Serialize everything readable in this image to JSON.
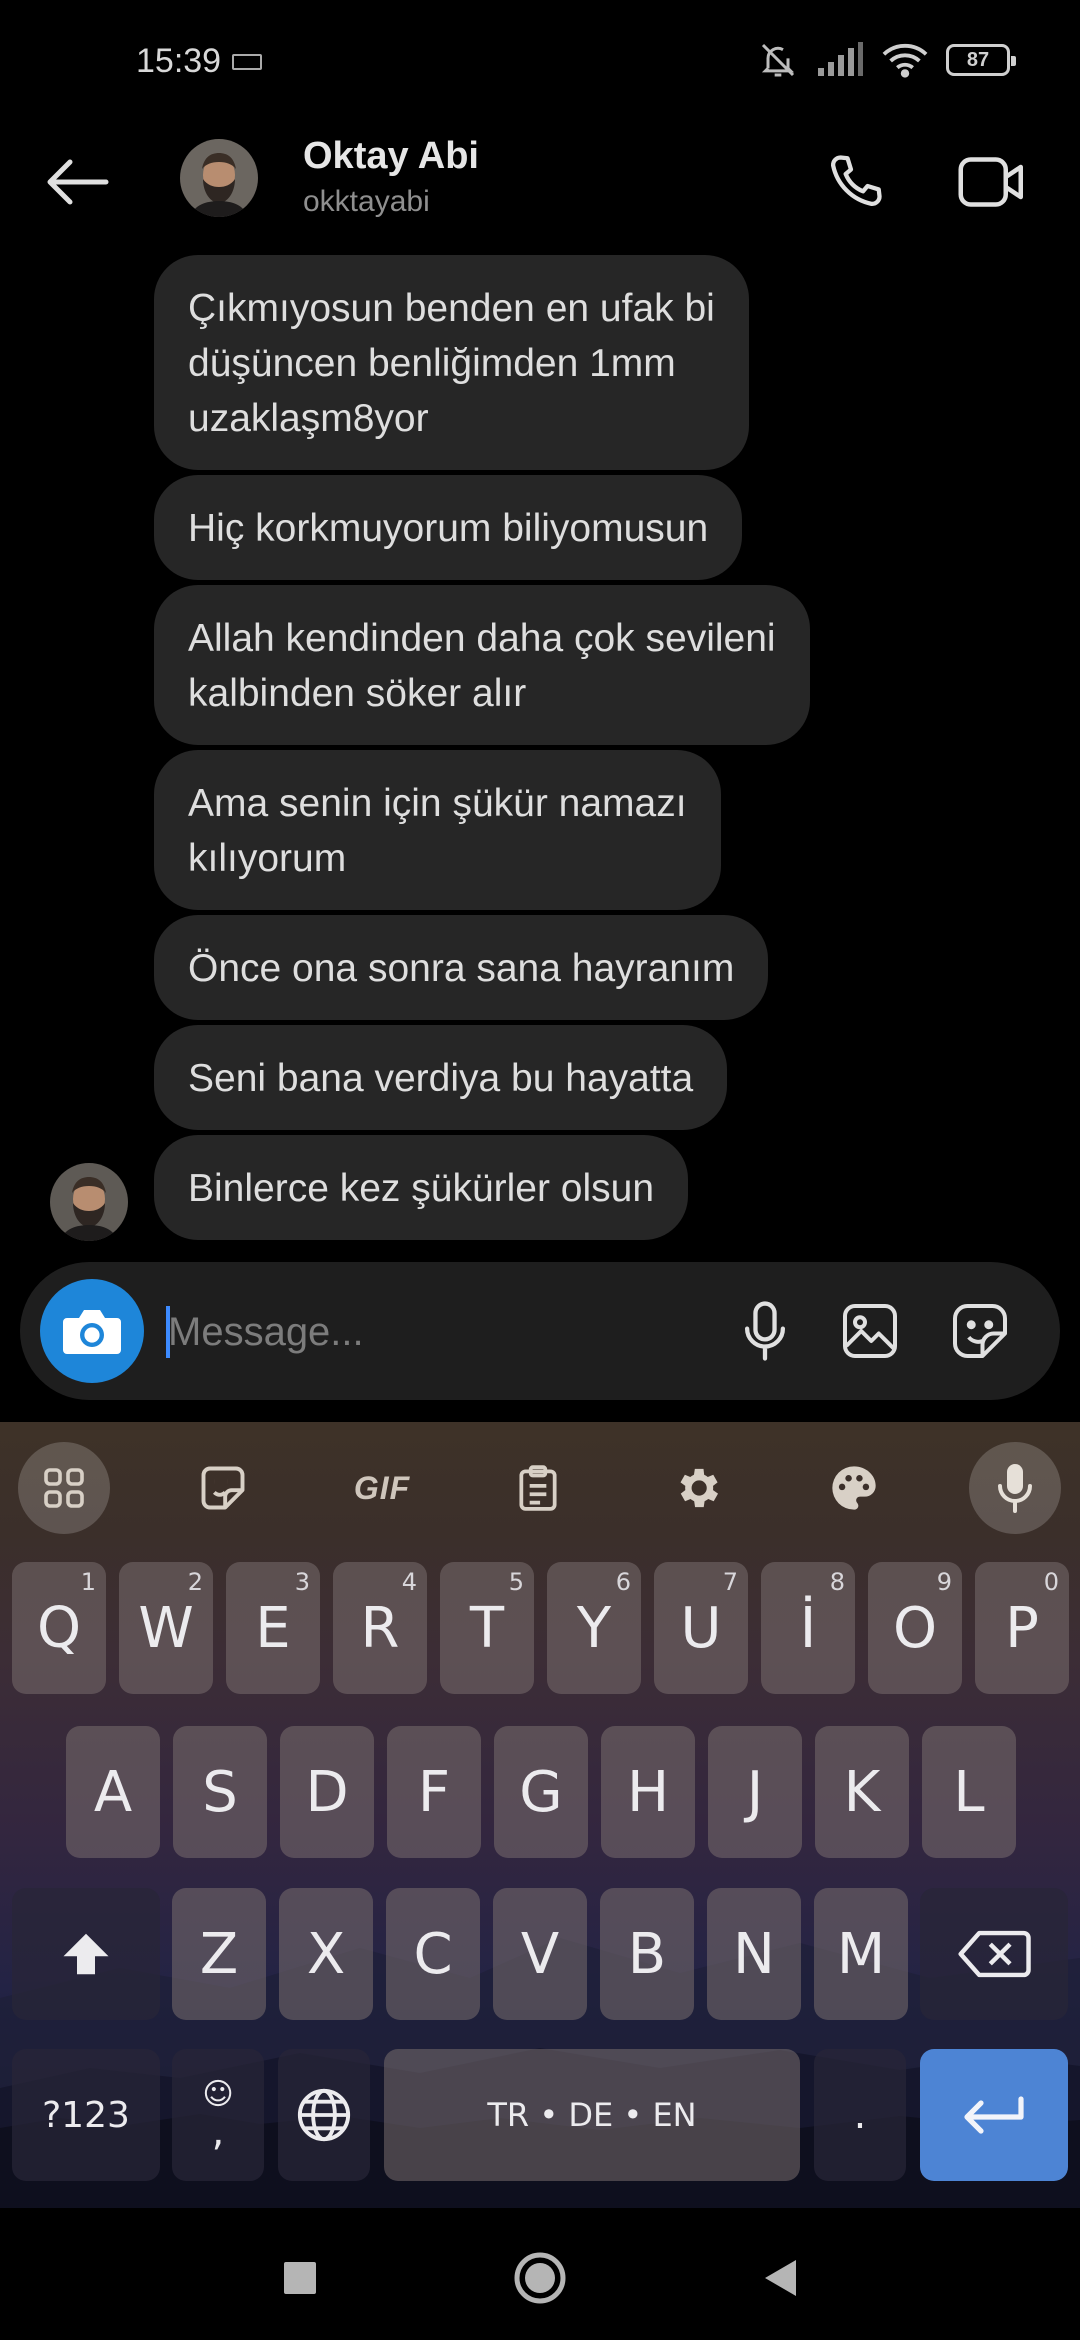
{
  "status_bar": {
    "time": "15:39",
    "battery": "87",
    "icons": [
      "keyboard-icon",
      "bell-off-icon",
      "signal-icon",
      "wifi-icon",
      "battery-icon"
    ]
  },
  "header": {
    "name": "Oktay Abi",
    "handle": "okktayabi"
  },
  "messages": [
    "Çıkmıyosun benden en ufak bi\ndüşüncen benliğimden 1mm\nuzaklaşm8yor",
    "Hiç korkmuyorum biliyomusun",
    "Allah kendinden daha çok sevileni\nkalbinden söker alır",
    "Ama senin için şükür namazı\nkılıyorum",
    "Önce ona sonra sana hayranım",
    "Seni bana verdiya bu hayatta",
    "Binlerce kez şükürler olsun"
  ],
  "composer": {
    "placeholder": "Message..."
  },
  "keyboard": {
    "toolbar": [
      "apps-icon",
      "sticker-icon",
      "GIF",
      "clipboard-icon",
      "settings-icon",
      "palette-icon",
      "mic-icon"
    ],
    "gif": "GIF",
    "row1": [
      {
        "k": "Q",
        "h": "1"
      },
      {
        "k": "W",
        "h": "2"
      },
      {
        "k": "E",
        "h": "3"
      },
      {
        "k": "R",
        "h": "4"
      },
      {
        "k": "T",
        "h": "5"
      },
      {
        "k": "Y",
        "h": "6"
      },
      {
        "k": "U",
        "h": "7"
      },
      {
        "k": "İ",
        "h": "8"
      },
      {
        "k": "O",
        "h": "9"
      },
      {
        "k": "P",
        "h": "0"
      }
    ],
    "row2": [
      "A",
      "S",
      "D",
      "F",
      "G",
      "H",
      "J",
      "K",
      "L"
    ],
    "row3": [
      "Z",
      "X",
      "C",
      "V",
      "B",
      "N",
      "M"
    ],
    "symbols": "?123",
    "comma": ",",
    "space": "TR • DE • EN",
    "period": "."
  },
  "colors": {
    "accent": "#1e86d9",
    "bubble": "#262626",
    "enter_key": "#4d84d4"
  }
}
